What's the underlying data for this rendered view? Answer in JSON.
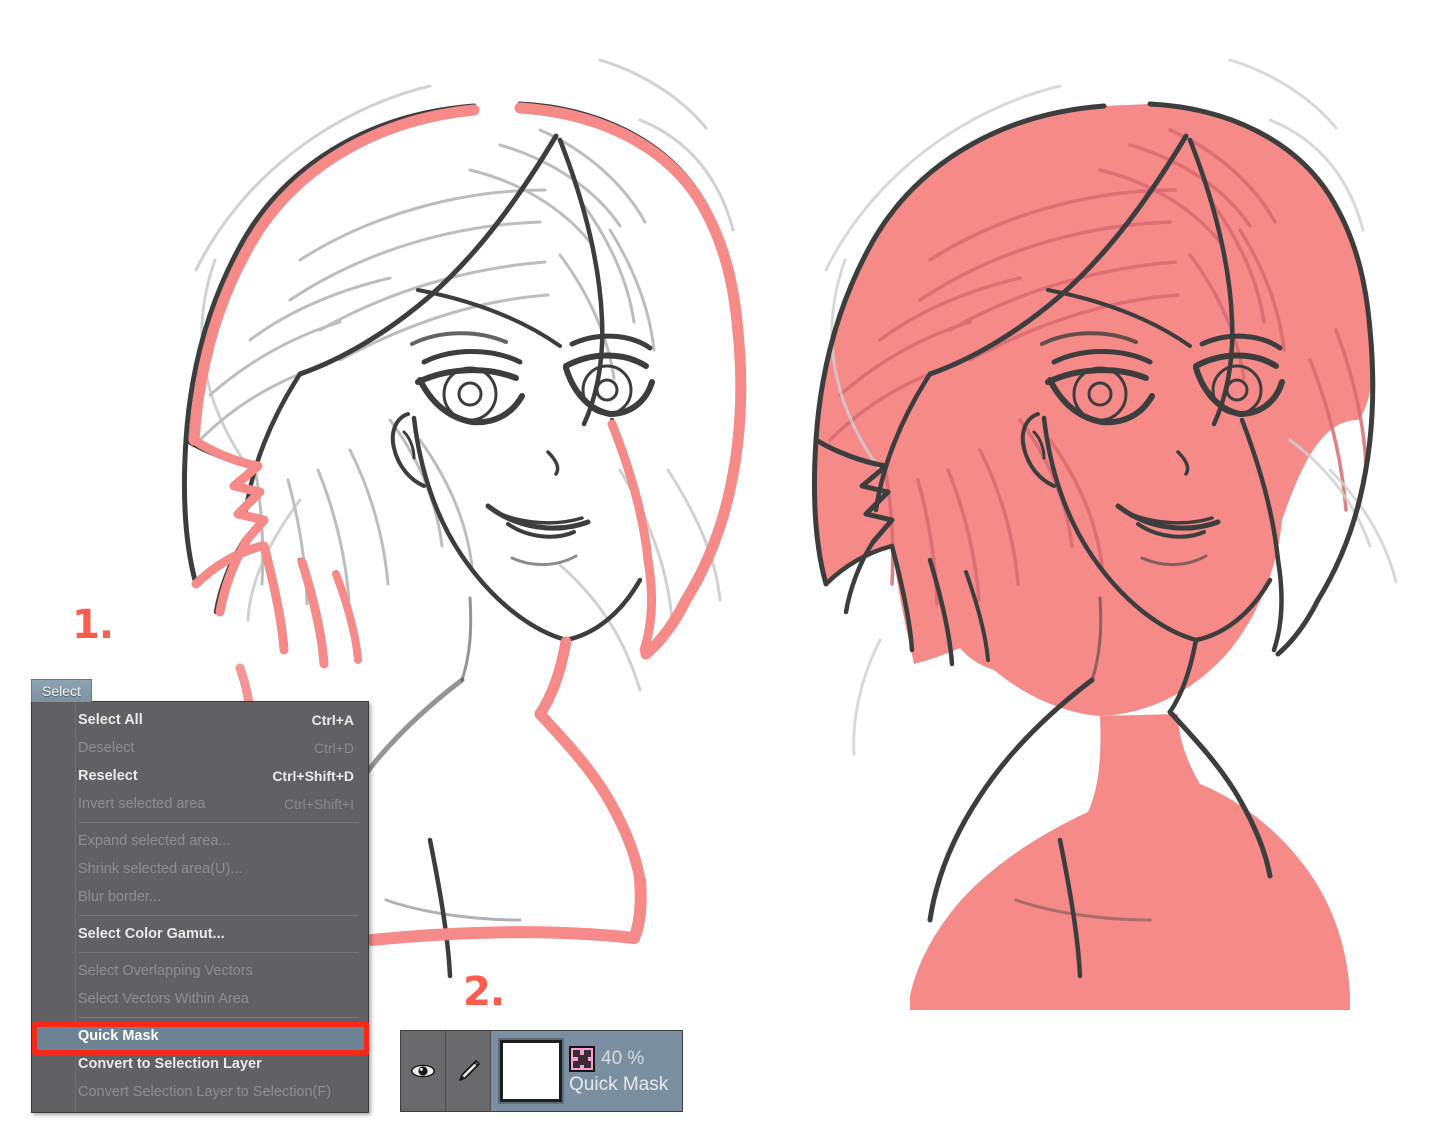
{
  "app": {
    "canvas_background": "#ffffff",
    "accent_red": "#fb5c4d",
    "quickmask_overlay": "#f58a89",
    "menu_highlight": "#6d8293",
    "callout_red": "#fb2719"
  },
  "annotations": [
    {
      "id": "step-1",
      "label": "1."
    },
    {
      "id": "step-2",
      "label": "2."
    }
  ],
  "menubar": {
    "select_label": "Select"
  },
  "select_menu": {
    "items": [
      {
        "label": "Select All",
        "shortcut": "Ctrl+A",
        "state": "enabled"
      },
      {
        "label": "Deselect",
        "shortcut": "Ctrl+D",
        "state": "disabled"
      },
      {
        "label": "Reselect",
        "shortcut": "Ctrl+Shift+D",
        "state": "enabled"
      },
      {
        "label": "Invert selected area",
        "shortcut": "Ctrl+Shift+I",
        "state": "disabled"
      },
      {
        "separator": true
      },
      {
        "label": "Expand selected area...",
        "shortcut": "",
        "state": "disabled"
      },
      {
        "label": "Shrink selected area(U)...",
        "shortcut": "",
        "state": "disabled"
      },
      {
        "label": "Blur border...",
        "shortcut": "",
        "state": "disabled"
      },
      {
        "separator": true
      },
      {
        "label": "Select Color Gamut...",
        "shortcut": "",
        "state": "enabled"
      },
      {
        "separator": true
      },
      {
        "label": "Select Overlapping Vectors",
        "shortcut": "",
        "state": "disabled"
      },
      {
        "label": "Select Vectors Within Area",
        "shortcut": "",
        "state": "disabled"
      },
      {
        "separator": true
      },
      {
        "label": "Quick Mask",
        "shortcut": "",
        "state": "highlighted"
      },
      {
        "label": "Convert to Selection Layer",
        "shortcut": "",
        "state": "enabled"
      },
      {
        "label": "Convert Selection Layer to Selection(F)",
        "shortcut": "",
        "state": "disabled"
      }
    ]
  },
  "layer_palette": {
    "visibility_icon": "eye-icon",
    "draw_icon": "pen-icon",
    "thumbnail": "white-canvas-thumbnail",
    "mask_swatch_icon": "quick-mask-swatch-icon",
    "opacity": "40 %",
    "layer_name": "Quick Mask"
  },
  "artwork": {
    "left_panel_caption": "line art sketch with partial quick-mask strokes",
    "right_panel_caption": "same sketch fully covered by quick-mask overlay"
  }
}
